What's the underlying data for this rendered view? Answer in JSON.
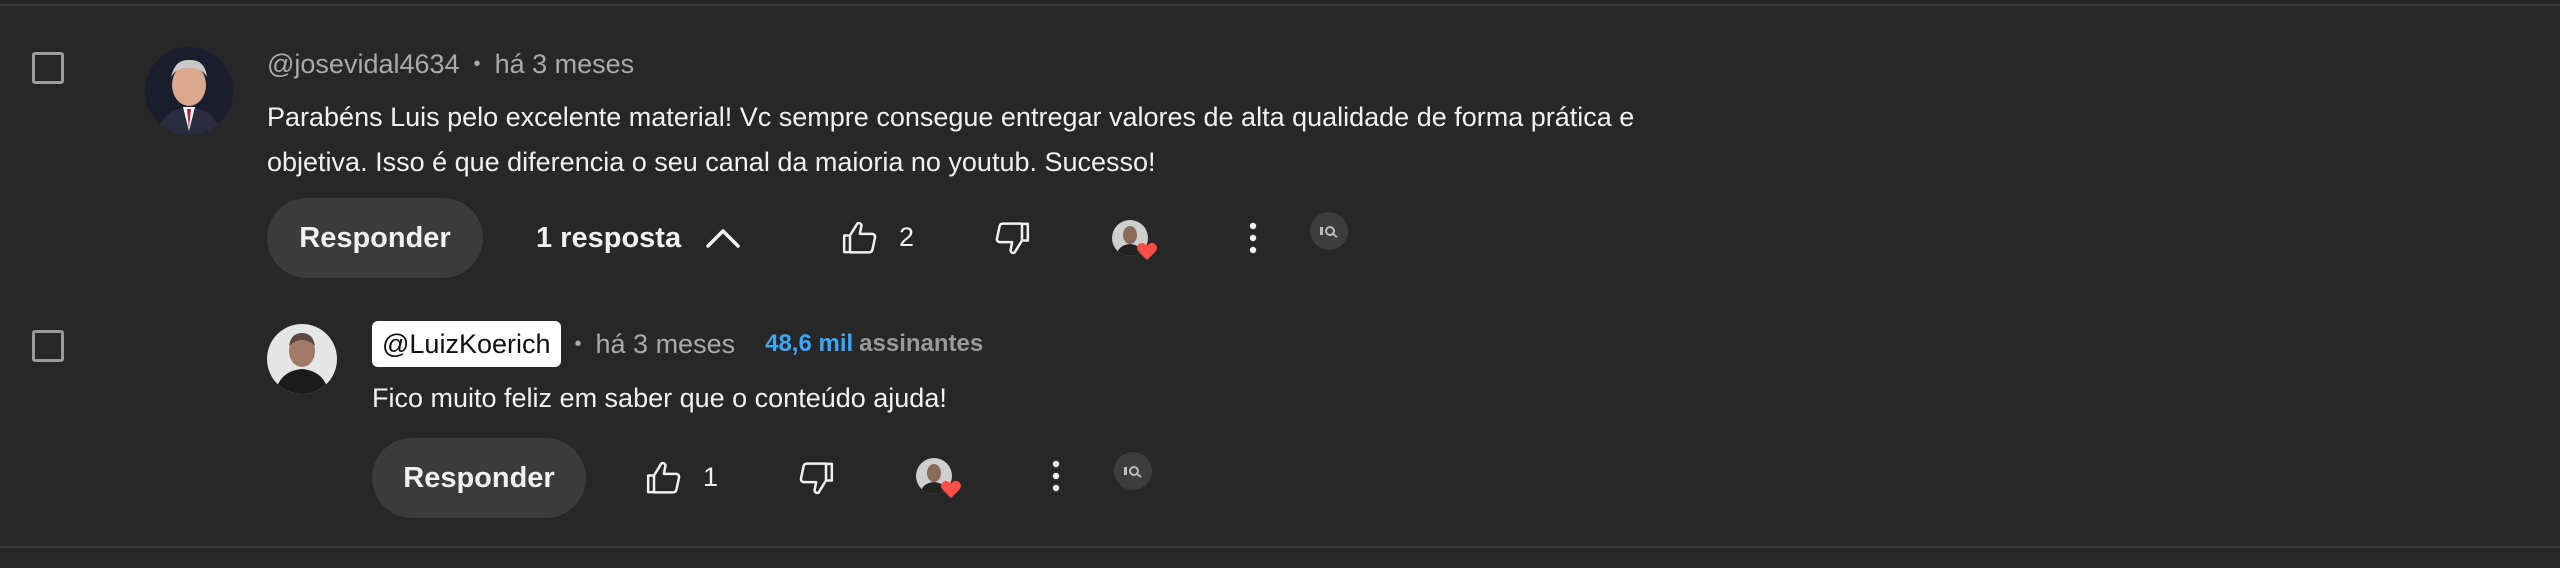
{
  "comment": {
    "handle": "@josevidal4634",
    "separator": "•",
    "time": "há 3 meses",
    "text_line1": "Parabéns Luis pelo excelente material! Vc sempre consegue entregar valores de alta qualidade de forma prática e",
    "text_line2": "objetiva. Isso é que diferencia o seu canal da maioria no youtub. Sucesso!",
    "reply_label": "Responder",
    "replies_toggle_label": "1 resposta",
    "like_count": "2",
    "icons": [
      "checkbox",
      "thumbs-up-icon",
      "thumbs-down-icon",
      "creator-heart",
      "more-vert-icon",
      "extension-icon",
      "chevron-up-icon"
    ]
  },
  "reply": {
    "handle": "@LuizKoerich",
    "separator": "•",
    "time": "há 3 meses",
    "subscribers_count": "48,6 mil",
    "subscribers_label": "assinantes",
    "text": "Fico muito feliz em saber que o conteúdo ajuda!",
    "reply_label": "Responder",
    "like_count": "1"
  },
  "colors": {
    "background": "#272727",
    "text_primary": "#f1f1f1",
    "text_secondary": "#aaaaaa",
    "subscriber_accent": "#3ea6ff",
    "button_bg": "#3b3b3b",
    "heart": "#ff4e45"
  }
}
